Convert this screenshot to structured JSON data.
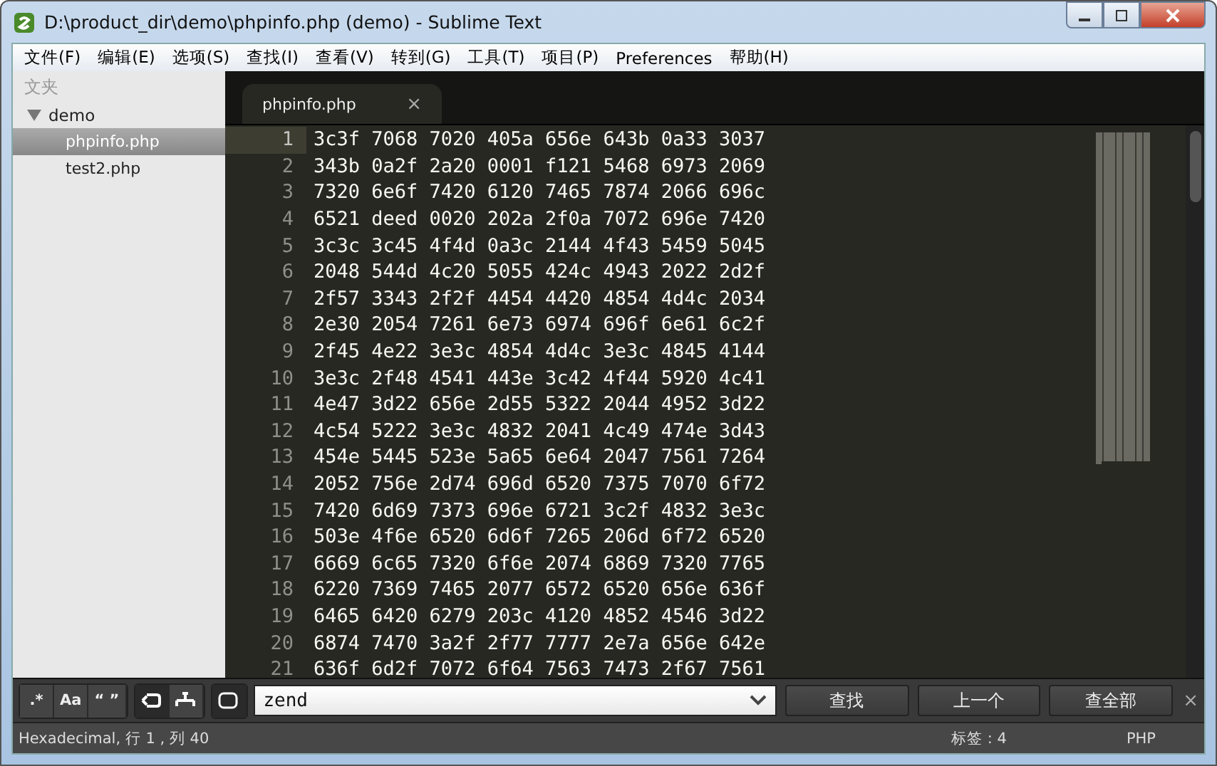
{
  "window": {
    "title": "D:\\product_dir\\demo\\phpinfo.php (demo) - Sublime Text"
  },
  "menu": [
    "文件(F)",
    "编辑(E)",
    "选项(S)",
    "查找(I)",
    "查看(V)",
    "转到(G)",
    "工具(T)",
    "项目(P)",
    "Preferences",
    "帮助(H)"
  ],
  "sidebar": {
    "heading": "文夹",
    "folder": {
      "name": "demo",
      "expanded": true,
      "children": [
        {
          "name": "phpinfo.php",
          "selected": true
        },
        {
          "name": "test2.php",
          "selected": false
        }
      ]
    }
  },
  "tabs": [
    {
      "label": "phpinfo.php",
      "close": "×",
      "selected": true
    }
  ],
  "editor": {
    "lines": [
      {
        "no": "1",
        "text": "3c3f 7068 7020 405a 656e 643b 0a33 3037",
        "current": true
      },
      {
        "no": "2",
        "text": "343b 0a2f 2a20 0001 f121 5468 6973 2069",
        "current": false
      },
      {
        "no": "3",
        "text": "7320 6e6f 7420 6120 7465 7874 2066 696c",
        "current": false
      },
      {
        "no": "4",
        "text": "6521 deed 0020 202a 2f0a 7072 696e 7420",
        "current": false
      },
      {
        "no": "5",
        "text": "3c3c 3c45 4f4d 0a3c 2144 4f43 5459 5045",
        "current": false
      },
      {
        "no": "6",
        "text": "2048 544d 4c20 5055 424c 4943 2022 2d2f",
        "current": false
      },
      {
        "no": "7",
        "text": "2f57 3343 2f2f 4454 4420 4854 4d4c 2034",
        "current": false
      },
      {
        "no": "8",
        "text": "2e30 2054 7261 6e73 6974 696f 6e61 6c2f",
        "current": false
      },
      {
        "no": "9",
        "text": "2f45 4e22 3e3c 4854 4d4c 3e3c 4845 4144",
        "current": false
      },
      {
        "no": "10",
        "text": "3e3c 2f48 4541 443e 3c42 4f44 5920 4c41",
        "current": false
      },
      {
        "no": "11",
        "text": "4e47 3d22 656e 2d55 5322 2044 4952 3d22",
        "current": false
      },
      {
        "no": "12",
        "text": "4c54 5222 3e3c 4832 2041 4c49 474e 3d43",
        "current": false
      },
      {
        "no": "13",
        "text": "454e 5445 523e 5a65 6e64 2047 7561 7264",
        "current": false
      },
      {
        "no": "14",
        "text": "2052 756e 2d74 696d 6520 7375 7070 6f72",
        "current": false
      },
      {
        "no": "15",
        "text": "7420 6d69 7373 696e 6721 3c2f 4832 3e3c",
        "current": false
      },
      {
        "no": "16",
        "text": "503e 4f6e 6520 6d6f 7265 206d 6f72 6520",
        "current": false
      },
      {
        "no": "17",
        "text": "6669 6c65 7320 6f6e 2074 6869 7320 7765",
        "current": false
      },
      {
        "no": "18",
        "text": "6220 7369 7465 2077 6572 6520 656e 636f",
        "current": false
      },
      {
        "no": "19",
        "text": "6465 6420 6279 203c 4120 4852 4546 3d22",
        "current": false
      },
      {
        "no": "20",
        "text": "6874 7470 3a2f 2f77 7777 2e7a 656e 642e",
        "current": false
      },
      {
        "no": "21",
        "text": "636f 6d2f 7072 6f64 7563 7473 2f67 7561",
        "current": false
      }
    ]
  },
  "find_panel": {
    "toggles": [
      {
        "kind": "text",
        "label": ".*",
        "on": false
      },
      {
        "kind": "text",
        "label": "Aa",
        "on": false
      },
      {
        "kind": "text",
        "label": "“ ”",
        "on": false
      },
      {
        "kind": "wrap",
        "on": true
      },
      {
        "kind": "selection",
        "on": false
      },
      {
        "kind": "highlight",
        "on": true
      }
    ],
    "query": "zend",
    "buttons": [
      "查找",
      "上一个",
      "查全部"
    ],
    "close": "×"
  },
  "status_bar": {
    "left": "Hexadecimal, 行 1 , 列 40",
    "tab_size": "标签 : 4",
    "syntax": "PHP"
  }
}
